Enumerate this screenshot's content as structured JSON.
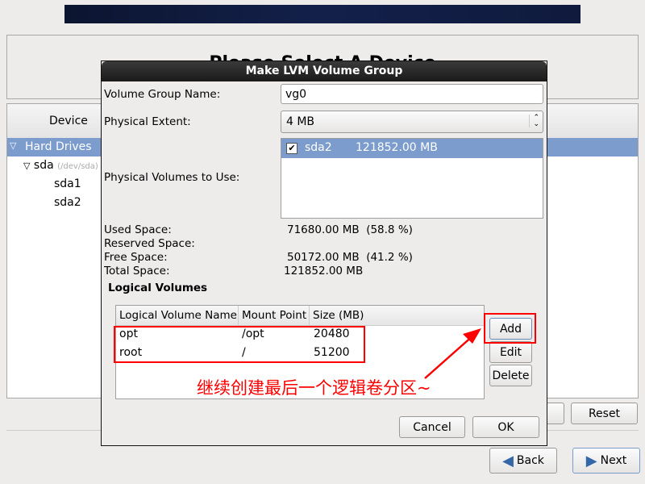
{
  "background": {
    "page_title": "Please Select A Device",
    "tree_header": "Device",
    "tree": [
      {
        "label": "Hard Drives"
      },
      {
        "label": "sda",
        "sub": "(/dev/sda)"
      },
      {
        "label": "sda1"
      },
      {
        "label": "sda2"
      }
    ],
    "reset_label": "Reset",
    "back_label": "Back",
    "next_label": "Next"
  },
  "dialog": {
    "title": "Make LVM Volume Group",
    "vg_name_label": "Volume Group Name:",
    "vg_name_value": "vg0",
    "pe_label": "Physical Extent:",
    "pe_value": "4 MB",
    "pv_label": "Physical Volumes to Use:",
    "pv_list": [
      {
        "name": "sda2",
        "size": "121852.00 MB",
        "checked": true
      }
    ],
    "stats": [
      {
        "label": "Used Space:",
        "value": "71680.00 MB  (58.8 %)"
      },
      {
        "label": "Reserved Space:",
        "value": ""
      },
      {
        "label": "Free Space:",
        "value": "50172.00 MB  (41.2 %)"
      },
      {
        "label": "Total Space:",
        "value": "121852.00 MB"
      }
    ],
    "lv_heading": "Logical Volumes",
    "lv_columns": [
      "Logical Volume Name",
      "Mount Point",
      "Size (MB)"
    ],
    "lv_rows": [
      [
        "opt",
        "/opt",
        "20480"
      ],
      [
        "root",
        "/",
        "51200"
      ]
    ],
    "add_label": "Add",
    "edit_label": "Edit",
    "delete_label": "Delete",
    "cancel_label": "Cancel",
    "ok_label": "OK"
  },
  "annotation": {
    "text": "继续创建最后一个逻辑卷分区~",
    "color": "#ff0000"
  },
  "colors": {
    "selection": "#7b9ccc",
    "banner": "#13204a"
  }
}
